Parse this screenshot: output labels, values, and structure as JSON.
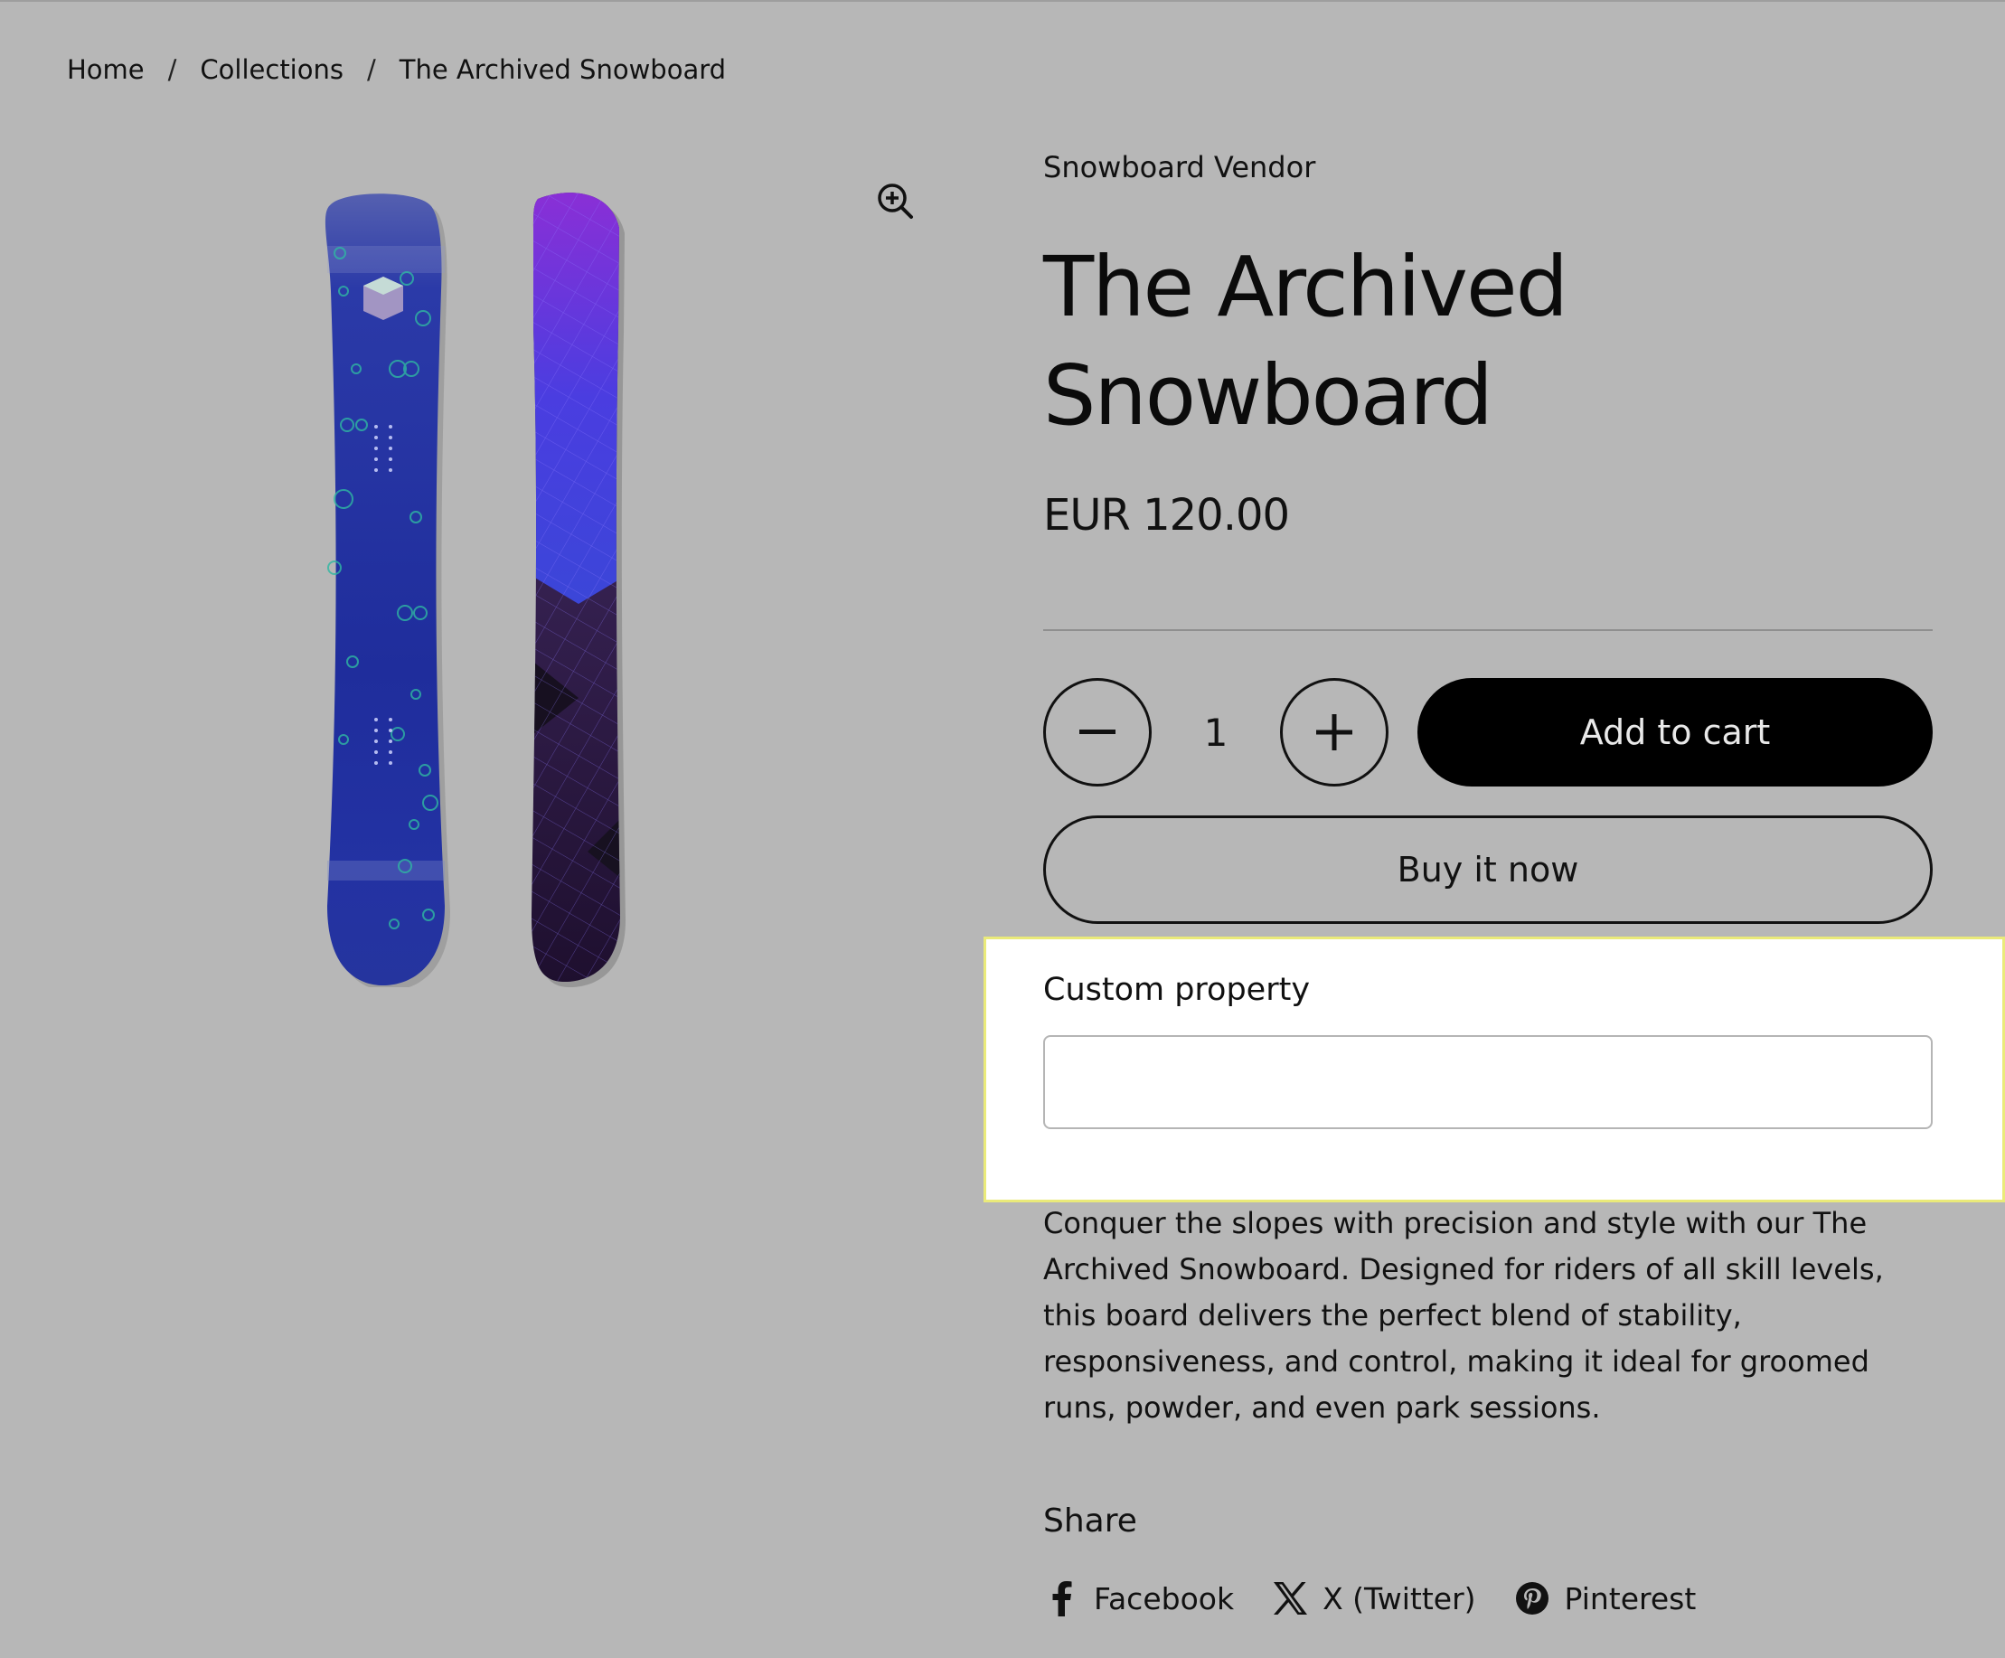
{
  "breadcrumb": {
    "items": [
      "Home",
      "Collections",
      "The Archived Snowboard"
    ],
    "separator": "/"
  },
  "gallery": {
    "image_alt": "The Archived Snowboard",
    "zoom_icon": "zoom-in-icon"
  },
  "product": {
    "vendor": "Snowboard Vendor",
    "title": "The Archived Snowboard",
    "price": "EUR 120.00",
    "quantity": "1",
    "add_to_cart_label": "Add to cart",
    "buy_now_label": "Buy it now",
    "custom_property_label": "Custom property",
    "custom_property_value": "",
    "description": "Conquer the slopes with precision and style with our The Archived Snowboard. Designed for riders of all skill levels, this board delivers the perfect blend of stability, responsiveness, and control, making it ideal for groomed runs, powder, and even park sessions."
  },
  "share": {
    "title": "Share",
    "links": [
      {
        "label": "Facebook",
        "icon": "facebook-icon"
      },
      {
        "label": "X (Twitter)",
        "icon": "x-twitter-icon"
      },
      {
        "label": "Pinterest",
        "icon": "pinterest-icon"
      }
    ]
  },
  "colors": {
    "page_background": "#b7b7b7",
    "primary_button": "#000000",
    "highlight_border": "#eaea7a"
  }
}
